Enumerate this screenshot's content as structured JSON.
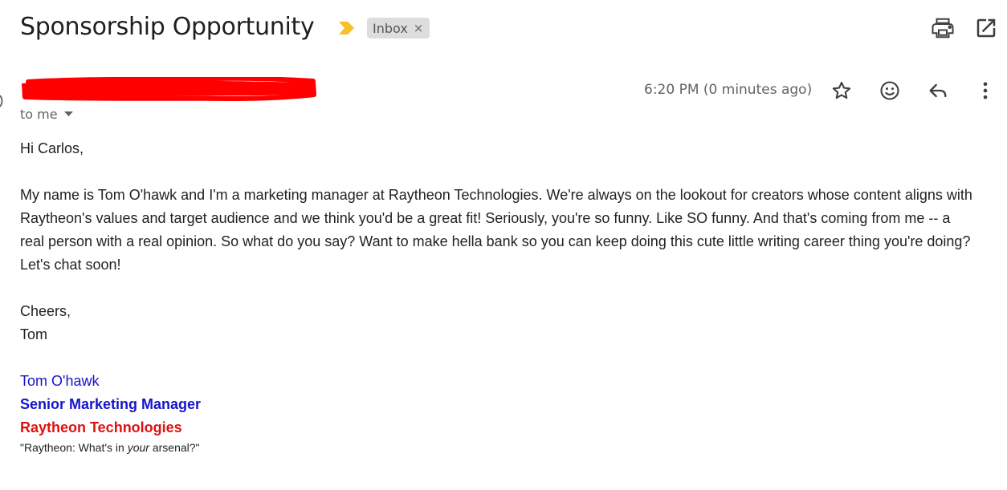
{
  "subject": "Sponsorship Opportunity",
  "label": {
    "text": "Inbox",
    "remove": "×"
  },
  "colors": {
    "importance": "#f6c026",
    "redaction": "#ff0000",
    "sig_blue": "#1515c9",
    "sig_red": "#e01010"
  },
  "toolbar": {
    "icons": [
      "print-icon",
      "open-in-new-window-icon"
    ]
  },
  "message": {
    "sender_redacted": "",
    "timestamp": "6:20 PM (0 minutes ago)",
    "recipient": "to me",
    "actions": [
      "star-icon",
      "emoji-reaction-icon",
      "reply-icon",
      "more-options-icon"
    ]
  },
  "body": {
    "greeting": "Hi Carlos,",
    "paragraph": "My name is Tom O'hawk and I'm a marketing manager at Raytheon Technologies. We're always on the lookout for creators whose content aligns with Raytheon's values and target audience and we think you'd be a great fit! Seriously, you're so funny. Like SO funny. And that's coming from me -- a real person with a real opinion. So what do you say? Want to make hella bank so you can keep doing this cute little writing career thing you're doing? Let's chat soon!",
    "closing": "Cheers,",
    "closing_name": "Tom"
  },
  "signature": {
    "name": "Tom O'hawk",
    "title": "Senior Marketing Manager",
    "company": "Raytheon Technologies",
    "tagline_before": "\"Raytheon: What's in ",
    "tagline_emphasis": "your",
    "tagline_after": " arsenal?\""
  }
}
